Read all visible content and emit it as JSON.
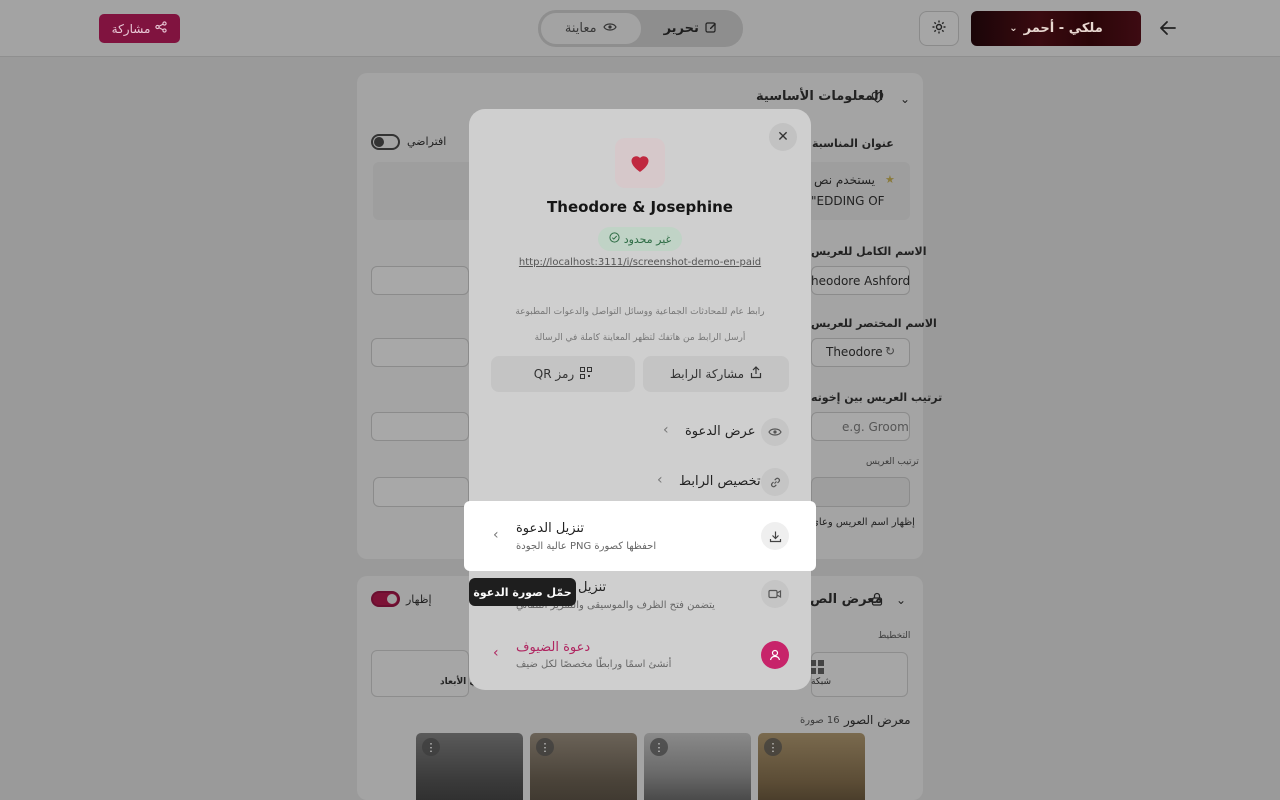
{
  "topbar": {
    "theme_label": "ملكي - أحمر",
    "edit_label": "تحرير",
    "preview_label": "معاينة",
    "share_label": "مشاركة"
  },
  "basic_info": {
    "section_title": "المعلومات الأساسية",
    "event_title_label": "عنوان المناسبة",
    "default_label": "افتراضي",
    "tip_line1": "يستخدم نص",
    "tip_line2": "EDDING OF\"",
    "groom_full_name_label": "الاسم الكامل للعريس",
    "groom_full_name_value": "heodore Ashford",
    "groom_short_name_label": "الاسم المختصر للعريس",
    "groom_short_name_value": "Theodore",
    "groom_order_label": "ترتيب العريس بين إخوته",
    "groom_order_placeholder": "e.g. Groom",
    "groom_order_hint": "ترتيب العريس",
    "show_names_hint": "إظهار اسم العريس وعائ"
  },
  "gallery": {
    "section_title": "معرض الص",
    "show_label": "إظهار",
    "layout_label": "التخطيط",
    "layout_option_grid": "شبكة",
    "layout_option_3d": "ثلاثي الأبعاد",
    "photos_label": "معرض الصور",
    "photos_count": "16 صورة"
  },
  "modal": {
    "title": "Theodore & Josephine",
    "badge": "غير محدود",
    "url": "http://localhost:3111/i/screenshot-demo-en-paid",
    "desc1": "رابط عام للمحادثات الجماعية ووسائل التواصل والدعوات المطبوعة",
    "desc2": "أرسل الرابط من هاتفك لتظهر المعاينة كاملة في الرسالة",
    "share_link": "مشاركة الرابط",
    "qr_code": "رمز QR",
    "view_invitation": "عرض الدعوة",
    "customize_link": "تخصيص الرابط",
    "download_title": "تنزيل الدعوة",
    "download_sub": "احفظها كصورة PNG عالية الجودة",
    "video_title": "تنزيل",
    "video_sub": "يتضمن فتح الظرف والموسيقى والتمرير التلقائي",
    "guests_title": "دعوة الضيوف",
    "guests_sub": "أنشئ اسمًا ورابطًا مخصصًا لكل ضيف",
    "tooltip": "حمّل صورة الدعوة"
  },
  "colors": {
    "accent": "#c7246a",
    "badge_green": "#2f6d46",
    "theme_dark": "#3a0a10"
  }
}
